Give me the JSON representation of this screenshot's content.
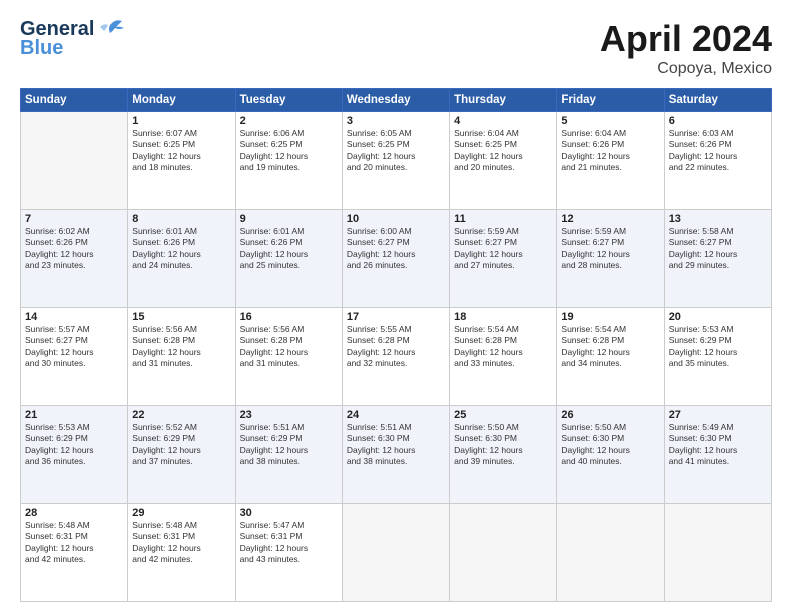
{
  "header": {
    "logo_line1": "General",
    "logo_line2": "Blue",
    "title": "April 2024",
    "subtitle": "Copoya, Mexico"
  },
  "columns": [
    "Sunday",
    "Monday",
    "Tuesday",
    "Wednesday",
    "Thursday",
    "Friday",
    "Saturday"
  ],
  "weeks": [
    [
      {
        "day": "",
        "sunrise": "",
        "sunset": "",
        "daylight": ""
      },
      {
        "day": "1",
        "sunrise": "Sunrise: 6:07 AM",
        "sunset": "Sunset: 6:25 PM",
        "daylight": "Daylight: 12 hours and 18 minutes."
      },
      {
        "day": "2",
        "sunrise": "Sunrise: 6:06 AM",
        "sunset": "Sunset: 6:25 PM",
        "daylight": "Daylight: 12 hours and 19 minutes."
      },
      {
        "day": "3",
        "sunrise": "Sunrise: 6:05 AM",
        "sunset": "Sunset: 6:25 PM",
        "daylight": "Daylight: 12 hours and 20 minutes."
      },
      {
        "day": "4",
        "sunrise": "Sunrise: 6:04 AM",
        "sunset": "Sunset: 6:25 PM",
        "daylight": "Daylight: 12 hours and 20 minutes."
      },
      {
        "day": "5",
        "sunrise": "Sunrise: 6:04 AM",
        "sunset": "Sunset: 6:26 PM",
        "daylight": "Daylight: 12 hours and 21 minutes."
      },
      {
        "day": "6",
        "sunrise": "Sunrise: 6:03 AM",
        "sunset": "Sunset: 6:26 PM",
        "daylight": "Daylight: 12 hours and 22 minutes."
      }
    ],
    [
      {
        "day": "7",
        "sunrise": "Sunrise: 6:02 AM",
        "sunset": "Sunset: 6:26 PM",
        "daylight": "Daylight: 12 hours and 23 minutes."
      },
      {
        "day": "8",
        "sunrise": "Sunrise: 6:01 AM",
        "sunset": "Sunset: 6:26 PM",
        "daylight": "Daylight: 12 hours and 24 minutes."
      },
      {
        "day": "9",
        "sunrise": "Sunrise: 6:01 AM",
        "sunset": "Sunset: 6:26 PM",
        "daylight": "Daylight: 12 hours and 25 minutes."
      },
      {
        "day": "10",
        "sunrise": "Sunrise: 6:00 AM",
        "sunset": "Sunset: 6:27 PM",
        "daylight": "Daylight: 12 hours and 26 minutes."
      },
      {
        "day": "11",
        "sunrise": "Sunrise: 5:59 AM",
        "sunset": "Sunset: 6:27 PM",
        "daylight": "Daylight: 12 hours and 27 minutes."
      },
      {
        "day": "12",
        "sunrise": "Sunrise: 5:59 AM",
        "sunset": "Sunset: 6:27 PM",
        "daylight": "Daylight: 12 hours and 28 minutes."
      },
      {
        "day": "13",
        "sunrise": "Sunrise: 5:58 AM",
        "sunset": "Sunset: 6:27 PM",
        "daylight": "Daylight: 12 hours and 29 minutes."
      }
    ],
    [
      {
        "day": "14",
        "sunrise": "Sunrise: 5:57 AM",
        "sunset": "Sunset: 6:27 PM",
        "daylight": "Daylight: 12 hours and 30 minutes."
      },
      {
        "day": "15",
        "sunrise": "Sunrise: 5:56 AM",
        "sunset": "Sunset: 6:28 PM",
        "daylight": "Daylight: 12 hours and 31 minutes."
      },
      {
        "day": "16",
        "sunrise": "Sunrise: 5:56 AM",
        "sunset": "Sunset: 6:28 PM",
        "daylight": "Daylight: 12 hours and 31 minutes."
      },
      {
        "day": "17",
        "sunrise": "Sunrise: 5:55 AM",
        "sunset": "Sunset: 6:28 PM",
        "daylight": "Daylight: 12 hours and 32 minutes."
      },
      {
        "day": "18",
        "sunrise": "Sunrise: 5:54 AM",
        "sunset": "Sunset: 6:28 PM",
        "daylight": "Daylight: 12 hours and 33 minutes."
      },
      {
        "day": "19",
        "sunrise": "Sunrise: 5:54 AM",
        "sunset": "Sunset: 6:28 PM",
        "daylight": "Daylight: 12 hours and 34 minutes."
      },
      {
        "day": "20",
        "sunrise": "Sunrise: 5:53 AM",
        "sunset": "Sunset: 6:29 PM",
        "daylight": "Daylight: 12 hours and 35 minutes."
      }
    ],
    [
      {
        "day": "21",
        "sunrise": "Sunrise: 5:53 AM",
        "sunset": "Sunset: 6:29 PM",
        "daylight": "Daylight: 12 hours and 36 minutes."
      },
      {
        "day": "22",
        "sunrise": "Sunrise: 5:52 AM",
        "sunset": "Sunset: 6:29 PM",
        "daylight": "Daylight: 12 hours and 37 minutes."
      },
      {
        "day": "23",
        "sunrise": "Sunrise: 5:51 AM",
        "sunset": "Sunset: 6:29 PM",
        "daylight": "Daylight: 12 hours and 38 minutes."
      },
      {
        "day": "24",
        "sunrise": "Sunrise: 5:51 AM",
        "sunset": "Sunset: 6:30 PM",
        "daylight": "Daylight: 12 hours and 38 minutes."
      },
      {
        "day": "25",
        "sunrise": "Sunrise: 5:50 AM",
        "sunset": "Sunset: 6:30 PM",
        "daylight": "Daylight: 12 hours and 39 minutes."
      },
      {
        "day": "26",
        "sunrise": "Sunrise: 5:50 AM",
        "sunset": "Sunset: 6:30 PM",
        "daylight": "Daylight: 12 hours and 40 minutes."
      },
      {
        "day": "27",
        "sunrise": "Sunrise: 5:49 AM",
        "sunset": "Sunset: 6:30 PM",
        "daylight": "Daylight: 12 hours and 41 minutes."
      }
    ],
    [
      {
        "day": "28",
        "sunrise": "Sunrise: 5:48 AM",
        "sunset": "Sunset: 6:31 PM",
        "daylight": "Daylight: 12 hours and 42 minutes."
      },
      {
        "day": "29",
        "sunrise": "Sunrise: 5:48 AM",
        "sunset": "Sunset: 6:31 PM",
        "daylight": "Daylight: 12 hours and 42 minutes."
      },
      {
        "day": "30",
        "sunrise": "Sunrise: 5:47 AM",
        "sunset": "Sunset: 6:31 PM",
        "daylight": "Daylight: 12 hours and 43 minutes."
      },
      {
        "day": "",
        "sunrise": "",
        "sunset": "",
        "daylight": ""
      },
      {
        "day": "",
        "sunrise": "",
        "sunset": "",
        "daylight": ""
      },
      {
        "day": "",
        "sunrise": "",
        "sunset": "",
        "daylight": ""
      },
      {
        "day": "",
        "sunrise": "",
        "sunset": "",
        "daylight": ""
      }
    ]
  ]
}
